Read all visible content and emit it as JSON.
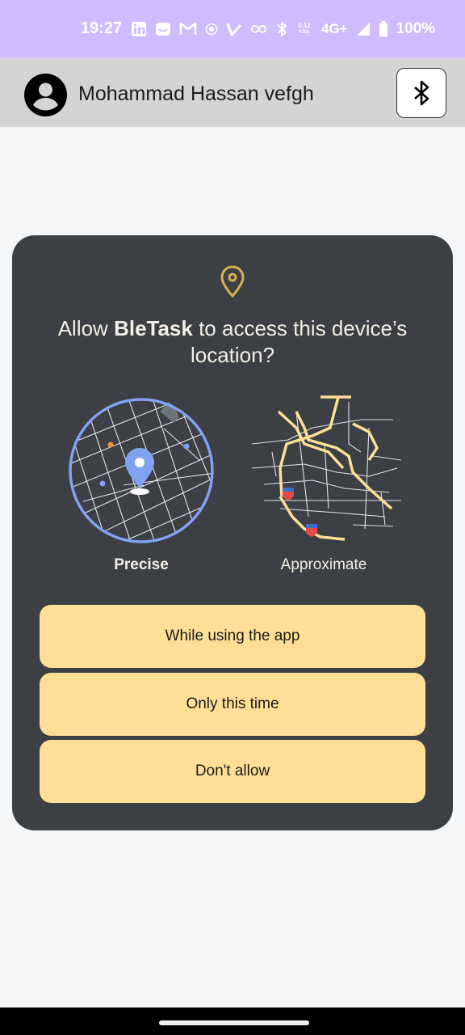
{
  "status_bar": {
    "time": "19:27",
    "network_speed_value": "0.12",
    "network_speed_unit": "KB/s",
    "network_type": "4G+",
    "battery": "100%",
    "icons": [
      "linkedin-icon",
      "message-icon",
      "gmail-icon",
      "record-icon",
      "check-icon",
      "key-icon",
      "bluetooth-icon",
      "signal-icon",
      "battery-icon"
    ],
    "background_color": "#cfbcff"
  },
  "app_bar": {
    "user_name": "Mohammad Hassan vefgh",
    "avatar_icon": "account-circle-icon",
    "bluetooth_button_icon": "bluetooth-icon"
  },
  "dialog": {
    "icon": "location-pin-icon",
    "title_prefix": "Allow ",
    "app_name": "BleTask",
    "title_suffix": " to access this device’s location?",
    "options": {
      "precise": "Precise",
      "approximate": "Approximate"
    },
    "selected_option": "precise",
    "buttons": {
      "while_using": "While using the app",
      "only_this_time": "Only this time",
      "dont_allow": "Don't allow"
    },
    "background_color": "#3c3f43",
    "button_color": "#ffdf96",
    "accent_color": "#7fa3f1"
  }
}
